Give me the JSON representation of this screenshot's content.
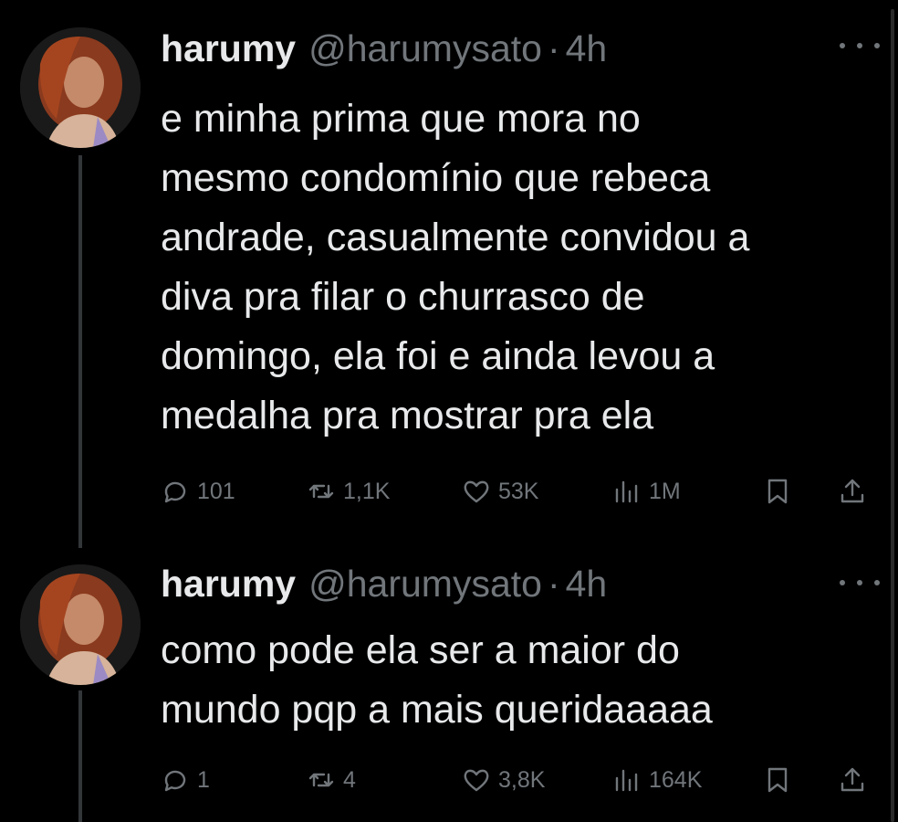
{
  "tweets": [
    {
      "name": "harumy",
      "handle": "@harumysato",
      "separator": "·",
      "time": "4h",
      "text": "e minha prima que mora no\nmesmo condomínio que rebeca\nandrade, casualmente convidou a\ndiva pra filar o churrasco de\ndomingo, ela foi e ainda levou a\nmedalha pra mostrar pra ela",
      "replies": "101",
      "retweets": "1,1K",
      "likes": "53K",
      "views": "1M"
    },
    {
      "name": "harumy",
      "handle": "@harumysato",
      "separator": "·",
      "time": "4h",
      "text": "como pode ela ser a maior do\nmundo pqp a mais queridaaaaa",
      "replies": "1",
      "retweets": "4",
      "likes": "3,8K",
      "views": "164K"
    }
  ],
  "icons": {
    "reply": "reply-icon",
    "retweet": "retweet-icon",
    "like": "heart-icon",
    "views": "views-icon",
    "bookmark": "bookmark-icon",
    "share": "share-icon",
    "more": "more-options-icon"
  },
  "colors": {
    "background": "#000000",
    "text": "#e7e9ea",
    "muted": "#71767b"
  }
}
